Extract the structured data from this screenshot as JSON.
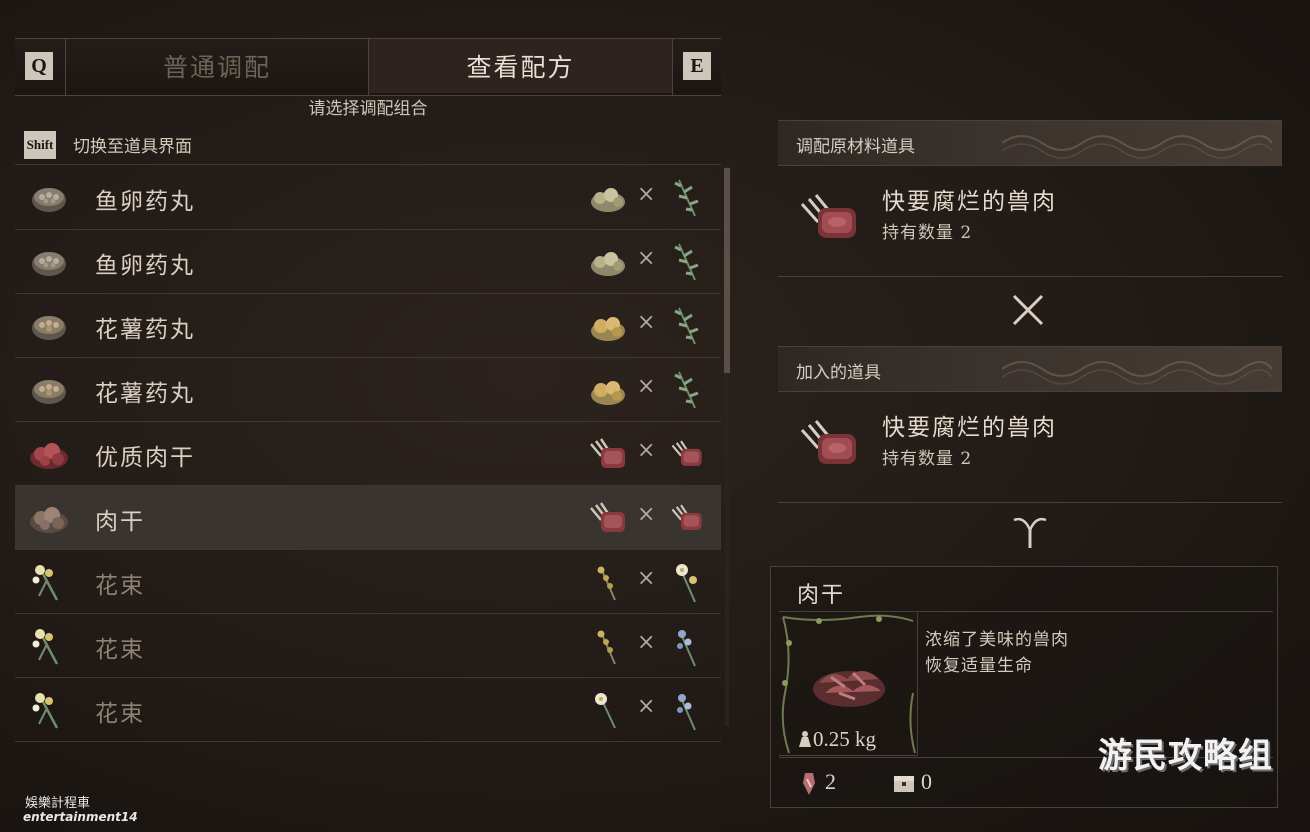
{
  "tabs": {
    "left_key": "Q",
    "right_key": "E",
    "items": [
      {
        "label": "普通调配",
        "active": false
      },
      {
        "label": "查看配方",
        "active": true
      }
    ]
  },
  "hint": "请选择调配组合",
  "shift_row": {
    "key": "Shift",
    "label": "切换至道具界面"
  },
  "recipes": [
    {
      "name": "鱼卵药丸",
      "icon": "fish-roe-pill-icon",
      "ing1": "herb-pile-icon",
      "ing2": "green-herb-icon",
      "available": true,
      "selected": false
    },
    {
      "name": "鱼卵药丸",
      "icon": "fish-roe-pill-icon",
      "ing1": "herb-pile-icon",
      "ing2": "green-herb-icon",
      "available": true,
      "selected": false
    },
    {
      "name": "花薯药丸",
      "icon": "flower-pill-icon",
      "ing1": "yellow-potato-icon",
      "ing2": "green-herb-icon",
      "available": true,
      "selected": false
    },
    {
      "name": "花薯药丸",
      "icon": "flower-pill-icon",
      "ing1": "yellow-potato-icon",
      "ing2": "green-herb-icon",
      "available": true,
      "selected": false
    },
    {
      "name": "优质肉干",
      "icon": "quality-jerky-icon",
      "ing1": "raw-meat-icon",
      "ing2": "raw-meat-icon",
      "available": true,
      "selected": false
    },
    {
      "name": "肉干",
      "icon": "jerky-icon",
      "ing1": "raw-meat-icon",
      "ing2": "raw-meat-icon",
      "available": true,
      "selected": true
    },
    {
      "name": "花束",
      "icon": "bouquet-icon",
      "ing1": "yellow-flower-icon",
      "ing2": "white-flower-icon",
      "available": false,
      "selected": false
    },
    {
      "name": "花束",
      "icon": "bouquet-icon",
      "ing1": "yellow-flower-icon",
      "ing2": "blue-flower-icon",
      "available": false,
      "selected": false
    },
    {
      "name": "花束",
      "icon": "bouquet-icon",
      "ing1": "white-flower-icon",
      "ing2": "blue-flower-icon",
      "available": false,
      "selected": false
    }
  ],
  "times_symbol": "×",
  "material_section": {
    "label": "调配原材料道具",
    "item_name": "快要腐烂的兽肉",
    "item_count": "持有数量 2"
  },
  "added_section": {
    "label": "加入的道具",
    "item_name": "快要腐烂的兽肉",
    "item_count": "持有数量 2"
  },
  "result": {
    "name": "肉干",
    "desc_line1": "浓缩了美味的兽肉",
    "desc_line2": "恢复适量生命",
    "weight": "0.25 kg",
    "owned": "2",
    "stored": "0"
  },
  "watermark": {
    "line1": "娛樂計程車",
    "line2": "entertainment14",
    "logo": "游民攻略组"
  },
  "colors": {
    "background": "#211a16",
    "selected_row": "#3a3430",
    "meat_red": "#8a3a3e",
    "herb_green": "#5e7a5a"
  }
}
